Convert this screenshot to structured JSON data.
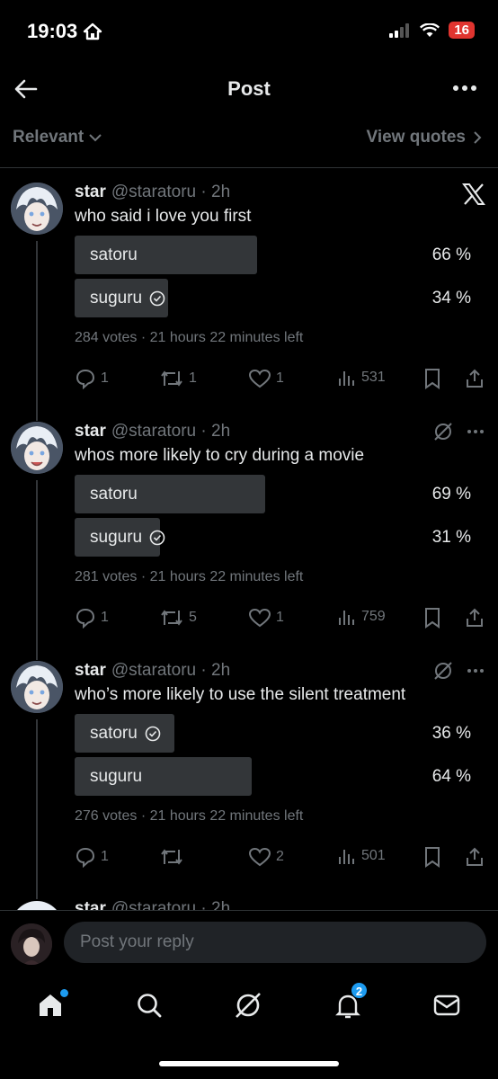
{
  "status_bar": {
    "time": "19:03",
    "battery": "16"
  },
  "header": {
    "title": "Post"
  },
  "subbar": {
    "sort_label": "Relevant",
    "view_quotes": "View quotes"
  },
  "posts": [
    {
      "name": "star",
      "handle": "@staratoru · 2h",
      "text": "who said i love you first",
      "options": [
        {
          "label": "satoru",
          "pct": "66 %",
          "fraction": 0.66,
          "checked": false
        },
        {
          "label": "suguru",
          "pct": "34 %",
          "fraction": 0.34,
          "checked": true
        }
      ],
      "meta": "284 votes · 21 hours 22 minutes left",
      "replies": "1",
      "reposts": "1",
      "likes": "1",
      "views": "531"
    },
    {
      "name": "star",
      "handle": "@staratoru · 2h",
      "text": "whos more likely to cry during a movie",
      "options": [
        {
          "label": "satoru",
          "pct": "69 %",
          "fraction": 0.69,
          "checked": false
        },
        {
          "label": "suguru",
          "pct": "31 %",
          "fraction": 0.31,
          "checked": true
        }
      ],
      "meta": "281 votes · 21 hours 22 minutes left",
      "replies": "1",
      "reposts": "5",
      "likes": "1",
      "views": "759"
    },
    {
      "name": "star",
      "handle": "@staratoru · 2h",
      "text": "who’s more likely to use the silent treatment",
      "options": [
        {
          "label": "satoru",
          "pct": "36 %",
          "fraction": 0.36,
          "checked": true
        },
        {
          "label": "suguru",
          "pct": "64 %",
          "fraction": 0.64,
          "checked": false
        }
      ],
      "meta": "276 votes · 21 hours 22 minutes left",
      "replies": "1",
      "reposts": "",
      "likes": "2",
      "views": "501"
    }
  ],
  "partial_post": {
    "name": "star",
    "handle": "@staratoru · 2h"
  },
  "reply": {
    "placeholder": "Post your reply"
  },
  "tabbar": {
    "notifications_count": "2"
  },
  "colors": {
    "background": "#000000",
    "text": "#e7e9ea",
    "muted": "#71767b",
    "poll_bar": "#333639",
    "accent": "#1d9bf0",
    "battery": "#e0342f"
  },
  "icons": [
    "home-icon",
    "search-icon",
    "grok-icon",
    "bell-icon",
    "mail-icon",
    "x-logo-icon",
    "reply-icon",
    "repost-icon",
    "like-icon",
    "views-icon",
    "bookmark-icon",
    "share-icon",
    "check-circle-icon"
  ]
}
